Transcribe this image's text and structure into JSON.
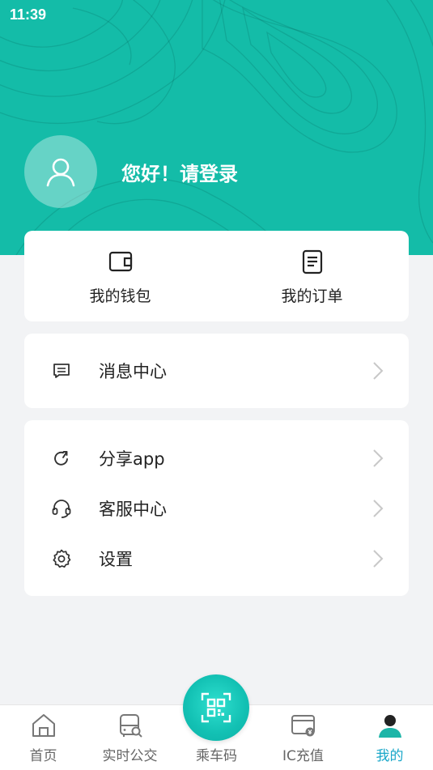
{
  "status_bar": {
    "time": "11:39"
  },
  "profile": {
    "greeting": "您好！请登录",
    "avatar_icon": "user-icon"
  },
  "quick_actions": [
    {
      "label": "我的钱包",
      "icon": "wallet-icon"
    },
    {
      "label": "我的订单",
      "icon": "order-document-icon"
    }
  ],
  "menu_primary": [
    {
      "label": "消息中心",
      "icon": "message-icon"
    }
  ],
  "menu_secondary": [
    {
      "label": "分享app",
      "icon": "share-icon"
    },
    {
      "label": "客服中心",
      "icon": "headset-icon"
    },
    {
      "label": "设置",
      "icon": "gear-icon"
    }
  ],
  "tabbar": {
    "tabs": [
      {
        "label": "首页",
        "icon": "home-icon"
      },
      {
        "label": "实时公交",
        "icon": "bus-search-icon"
      },
      {
        "label": "乘车码",
        "icon": "qr-code-icon"
      },
      {
        "label": "IC充值",
        "icon": "card-recharge-icon"
      },
      {
        "label": "我的",
        "icon": "user-icon"
      }
    ],
    "active_index": 4
  },
  "colors": {
    "brand": "#14bca8",
    "active_tab": "#1aa7c9",
    "background": "#f2f3f5"
  }
}
